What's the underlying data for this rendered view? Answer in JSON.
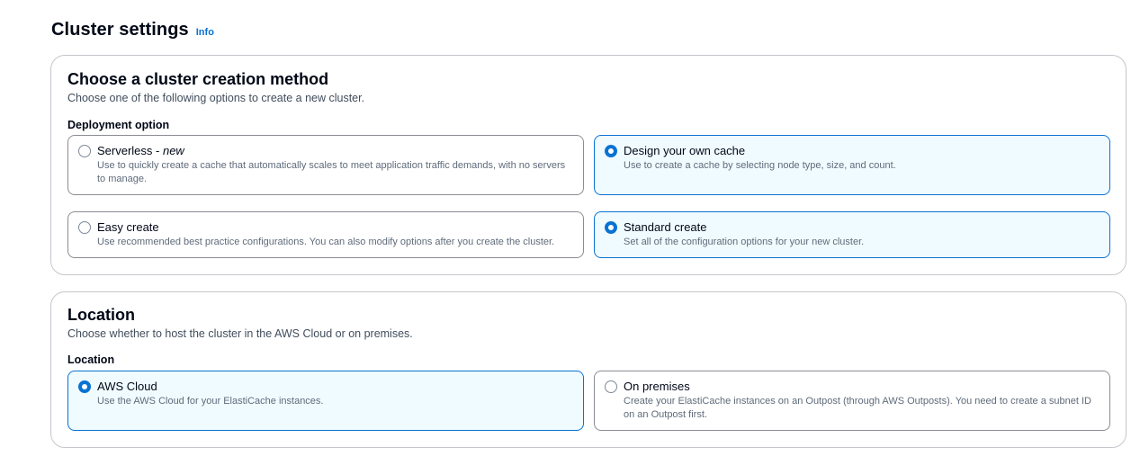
{
  "header": {
    "title": "Cluster settings",
    "info_label": "Info"
  },
  "creation_method": {
    "title": "Choose a cluster creation method",
    "description": "Choose one of the following options to create a new cluster.",
    "deployment_label": "Deployment option",
    "deployment_options": [
      {
        "label": "Serverless - ",
        "label_suffix": "new",
        "description": "Use to quickly create a cache that automatically scales to meet application traffic demands, with no servers to manage.",
        "selected": false
      },
      {
        "label": "Design your own cache",
        "description": "Use to create a cache by selecting node type, size, and count.",
        "selected": true
      }
    ],
    "config_options": [
      {
        "label": "Easy create",
        "description": "Use recommended best practice configurations. You can also modify options after you create the cluster.",
        "selected": false
      },
      {
        "label": "Standard create",
        "description": "Set all of the configuration options for your new cluster.",
        "selected": true
      }
    ]
  },
  "location": {
    "title": "Location",
    "description": "Choose whether to host the cluster in the AWS Cloud or on premises.",
    "field_label": "Location",
    "options": [
      {
        "label": "AWS Cloud",
        "description": "Use the AWS Cloud for your ElastiCache instances.",
        "selected": true
      },
      {
        "label": "On premises",
        "description": "Create your ElastiCache instances on an Outpost (through AWS Outposts). You need to create a subnet ID on an Outpost first.",
        "selected": false
      }
    ]
  },
  "colors": {
    "accent": "#0972d3",
    "selected_bg": "#f0fbff",
    "border": "#8c8c94"
  }
}
